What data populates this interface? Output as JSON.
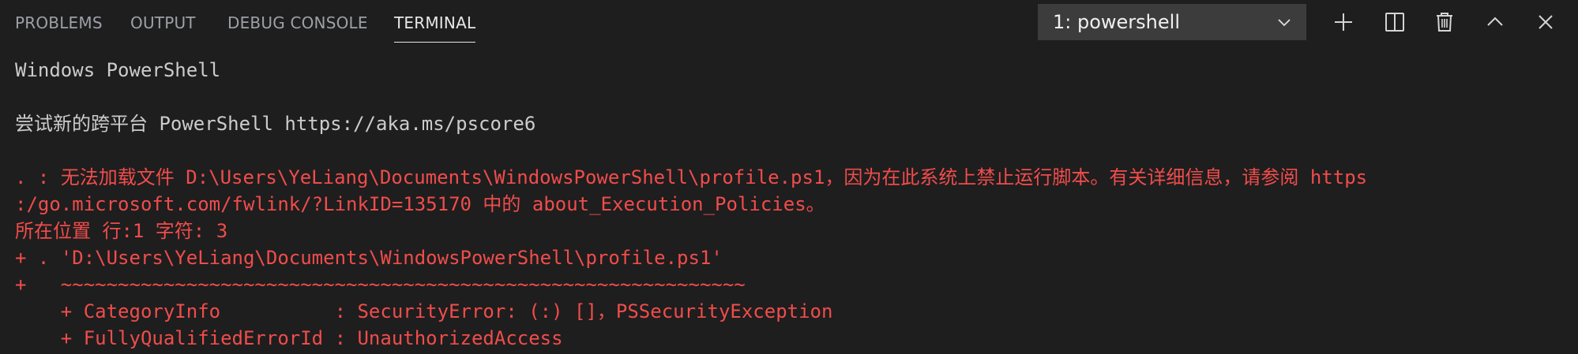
{
  "tabs": [
    {
      "label": "PROBLEMS",
      "active": false
    },
    {
      "label": "OUTPUT",
      "active": false
    },
    {
      "label": "DEBUG CONSOLE",
      "active": false
    },
    {
      "label": "TERMINAL",
      "active": true
    }
  ],
  "terminal_select": {
    "selected": "1: powershell"
  },
  "actions": [
    {
      "name": "new-terminal",
      "icon": "plus-icon"
    },
    {
      "name": "split-terminal",
      "icon": "split-icon"
    },
    {
      "name": "kill-terminal",
      "icon": "trash-icon"
    },
    {
      "name": "maximize-panel",
      "icon": "chevron-up-icon"
    },
    {
      "name": "close-panel",
      "icon": "close-icon"
    }
  ],
  "colors": {
    "background": "#1e1e1e",
    "text": "#cccccc",
    "error": "#f14c4c",
    "dropdown_bg": "#3c3c3c"
  },
  "terminal": {
    "lines": [
      {
        "text": "Windows PowerShell",
        "style": "normal"
      },
      {
        "text": "",
        "style": "normal"
      },
      {
        "text": "尝试新的跨平台 PowerShell https://aka.ms/pscore6",
        "style": "normal"
      },
      {
        "text": "",
        "style": "normal"
      },
      {
        "text": ". : 无法加载文件 D:\\Users\\YeLiang\\Documents\\WindowsPowerShell\\profile.ps1，因为在此系统上禁止运行脚本。有关详细信息，请参阅 https",
        "style": "error"
      },
      {
        "text": ":/go.microsoft.com/fwlink/?LinkID=135170 中的 about_Execution_Policies。",
        "style": "error"
      },
      {
        "text": "所在位置 行:1 字符: 3",
        "style": "error"
      },
      {
        "text": "+ . 'D:\\Users\\YeLiang\\Documents\\WindowsPowerShell\\profile.ps1'",
        "style": "error"
      },
      {
        "text": "+   ~~~~~~~~~~~~~~~~~~~~~~~~~~~~~~~~~~~~~~~~~~~~~~~~~~~~~~~~~~~~",
        "style": "error"
      },
      {
        "text": "    + CategoryInfo          : SecurityError: (:) []，PSSecurityException",
        "style": "error"
      },
      {
        "text": "    + FullyQualifiedErrorId : UnauthorizedAccess",
        "style": "error"
      }
    ]
  }
}
